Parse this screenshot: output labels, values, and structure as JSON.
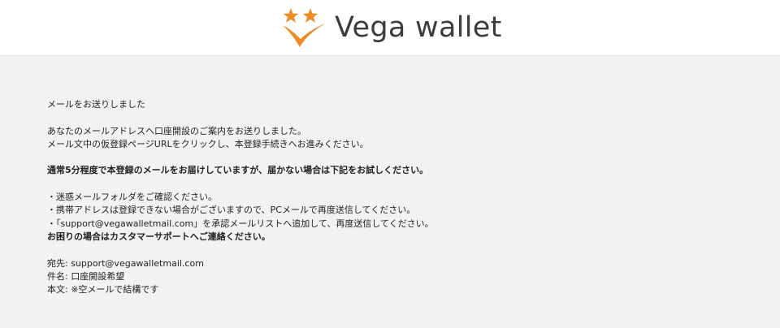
{
  "header": {
    "brand": "Vega wallet",
    "logo_icon": "vega-stars-v-logo",
    "colors": {
      "brand_orange": "#f08a24",
      "header_bg": "#ffffff",
      "page_bg": "#f2f2f2"
    }
  },
  "main": {
    "sent_title": "メールをお送りしました",
    "intro_1": "あなたのメールアドレスへ口座開設のご案内をお送りしました。",
    "intro_2": "メール文中の仮登録ページURLをクリックし、本登録手続きへお進みください。",
    "notice": "通常5分程度で本登録のメールをお届けしていますが、届かない場合は下記をお試しください。",
    "tip_1": "・迷惑メールフォルダをご確認ください。",
    "tip_2": "・携帯アドレスは登録できない場合がございますので、PCメールで再度送信してください。",
    "tip_3": "・「support@vegawalletmail.com」を承認メールリストへ追加して、再度送信してください。",
    "support_heading": "お困りの場合はカスタマーサポートへご連絡ください。",
    "to_line": "宛先: support@vegawalletmail.com",
    "subject_line": "件名: 口座開設希望",
    "body_line": "本文: ※空メールで結構です"
  }
}
